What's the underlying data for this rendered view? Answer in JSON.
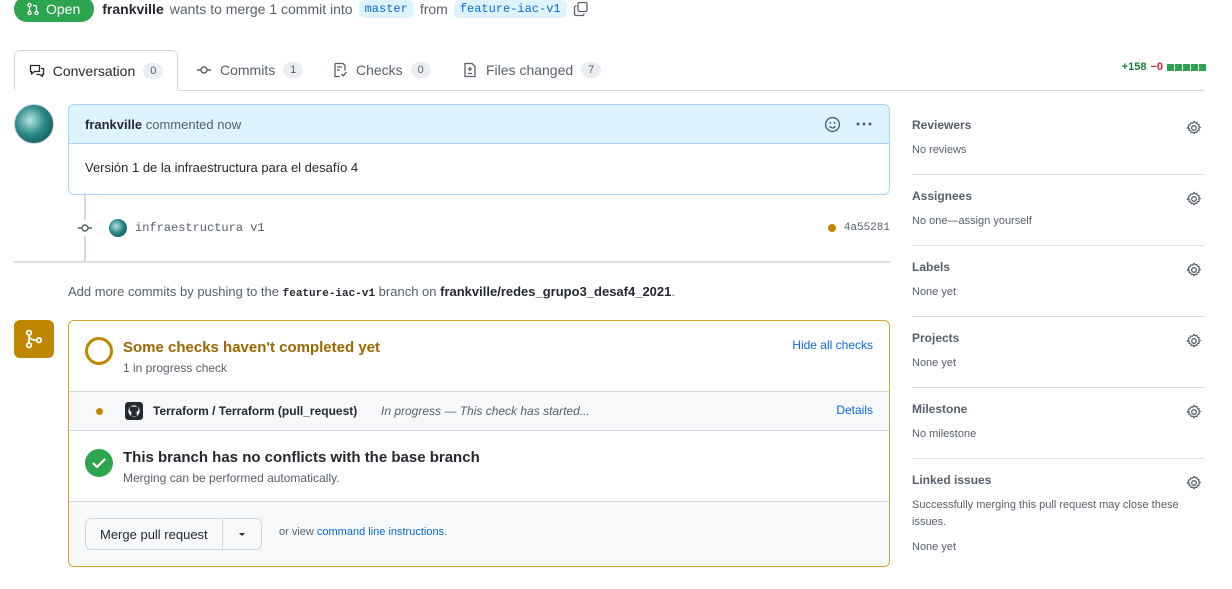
{
  "header": {
    "state_label": "Open",
    "author": "frankville",
    "action_text": "wants to merge 1 commit into",
    "base_branch": "master",
    "from_text": "from",
    "head_branch": "feature-iac-v1"
  },
  "tabs": [
    {
      "label": "Conversation",
      "count": "0",
      "icon": "comment-discussion-icon"
    },
    {
      "label": "Commits",
      "count": "1",
      "icon": "git-commit-icon"
    },
    {
      "label": "Checks",
      "count": "0",
      "icon": "checklist-icon"
    },
    {
      "label": "Files changed",
      "count": "7",
      "icon": "file-diff-icon"
    }
  ],
  "diffstat": {
    "additions": "+158",
    "deletions": "−0"
  },
  "comment": {
    "author": "frankville",
    "time_text": "commented now",
    "body": "Versión 1 de la infraestructura para el desafío 4"
  },
  "commit": {
    "message": "infraestructura v1",
    "sha": "4a55281"
  },
  "push_hint": {
    "prefix": "Add more commits by pushing to the",
    "branch": "feature-iac-v1",
    "middle": "branch on",
    "repo": "frankville/redes_grupo3_desaf4_2021",
    "suffix": "."
  },
  "checks": {
    "title": "Some checks haven't completed yet",
    "subtitle": "1 in progress check",
    "hide_label": "Hide all checks",
    "items": [
      {
        "name": "Terraform / Terraform (pull_request)",
        "status": "In progress — This check has started...",
        "details_label": "Details"
      }
    ]
  },
  "conflicts": {
    "title": "This branch has no conflicts with the base branch",
    "subtitle": "Merging can be performed automatically."
  },
  "merge": {
    "button_label": "Merge pull request",
    "or_view": "or view",
    "cli_link": "command line instructions",
    "period": "."
  },
  "sidebar": [
    {
      "title": "Reviewers",
      "value": "No reviews"
    },
    {
      "title": "Assignees",
      "value": "No one—assign yourself"
    },
    {
      "title": "Labels",
      "value": "None yet"
    },
    {
      "title": "Projects",
      "value": "None yet"
    },
    {
      "title": "Milestone",
      "value": "No milestone"
    },
    {
      "title": "Linked issues",
      "value": "Successfully merging this pull request may close these issues.",
      "value2": "None yet"
    }
  ],
  "colors": {
    "open": "#2da44e",
    "pending": "#bf8700",
    "link": "#0969da"
  }
}
